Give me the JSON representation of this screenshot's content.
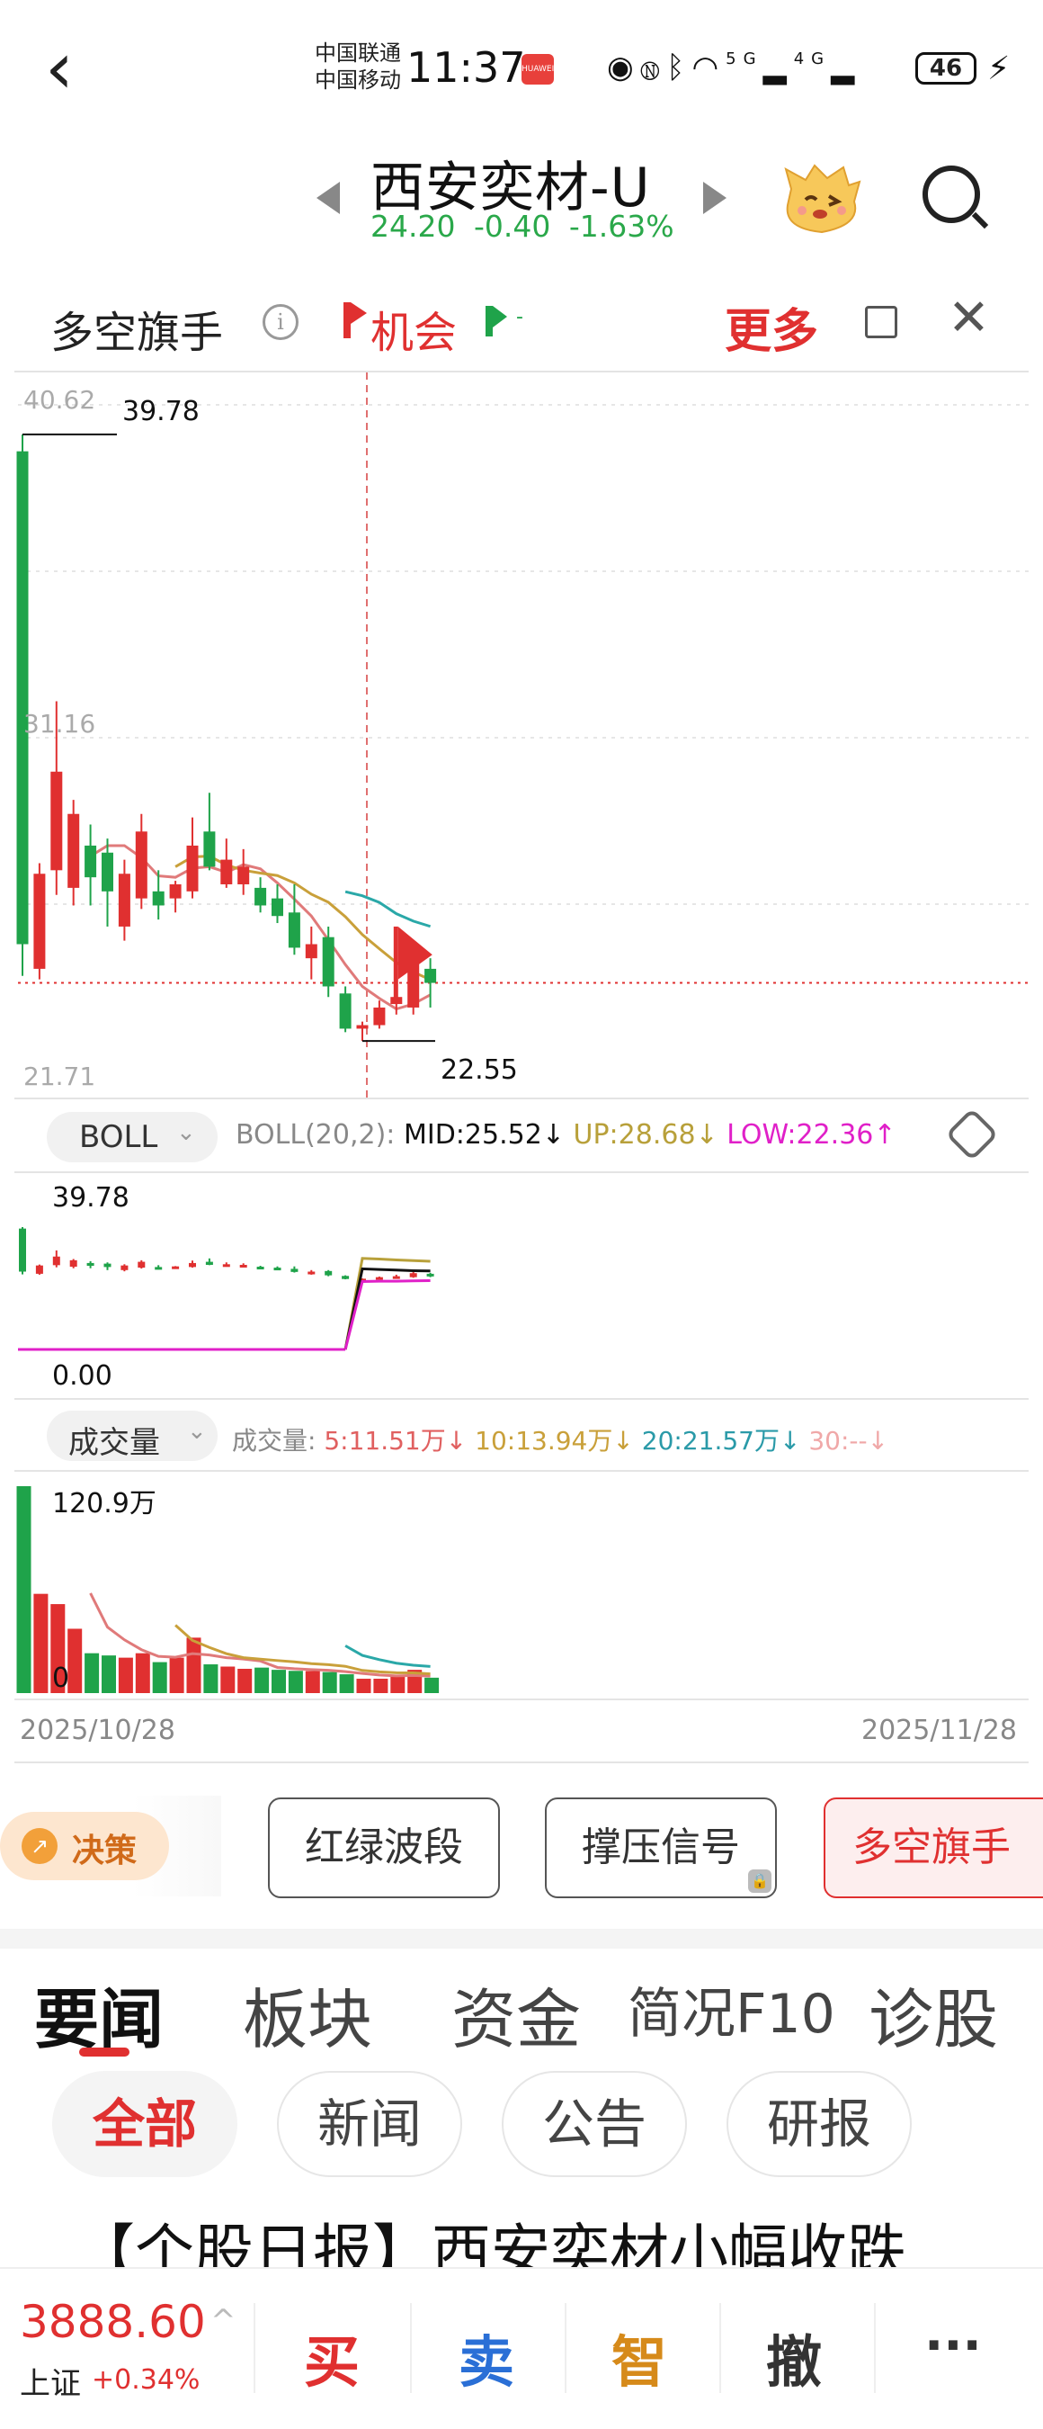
{
  "status_bar": {
    "carrier_1": "中国联通",
    "carrier_2": "中国移动",
    "time": "11:37",
    "net_1": "5G",
    "net_2": "4G",
    "battery": "46"
  },
  "header": {
    "stock_name": "西安奕材-U",
    "price": "24.20",
    "change": "-0.40",
    "change_pct": "-1.63%"
  },
  "tool": {
    "name": "多空旗手",
    "chance_label": "机会",
    "flag_label": "-",
    "more": "更多"
  },
  "main_chart": {
    "top_price": "40.62",
    "mid_price": "31.16",
    "bottom_price": "21.71",
    "high_marker": "39.78",
    "low_marker": "22.55"
  },
  "boll": {
    "selector": "BOLL",
    "params": "BOLL(20,2):",
    "mid": "MID:25.52",
    "up": "UP:28.68",
    "low": "LOW:22.36",
    "top_value": "39.78",
    "bottom_value": "0.00"
  },
  "volume": {
    "selector": "成交量",
    "label": "成交量:",
    "ma5": "5:11.51万",
    "ma10": "10:13.94万",
    "ma20": "20:21.57万",
    "ma30": "30:--",
    "top_value": "120.9万",
    "zero": "0",
    "date_start": "2025/10/28",
    "date_end": "2025/11/28"
  },
  "indicator_buttons": {
    "decision": "决策",
    "items": [
      "红绿波段",
      "撑压信号",
      "多空旗手"
    ]
  },
  "news_tabs": [
    "要闻",
    "板块",
    "资金",
    "简况F10",
    "诊股"
  ],
  "news_filters": [
    "全部",
    "新闻",
    "公告",
    "研报"
  ],
  "headline": "【个股日报】西安奕材小幅收跌",
  "bottom_bar": {
    "index_value": "3888.60",
    "index_name": "上证",
    "index_change": "+0.34%",
    "buy": "买",
    "sell": "卖",
    "smart": "智",
    "cancel": "撤",
    "more": "···"
  },
  "colors": {
    "up": "#e03030",
    "down": "#1fa34a",
    "boll_up": "#b8a03a",
    "boll_low": "#e020c8"
  },
  "chart_data": {
    "type": "candlestick",
    "x_range": [
      "2025/10/28",
      "2025/11/28"
    ],
    "ylim": [
      21.71,
      40.62
    ],
    "candles": [
      {
        "o": 39.3,
        "h": 39.78,
        "l": 24.4,
        "c": 25.3
      },
      {
        "o": 24.6,
        "h": 27.6,
        "l": 24.3,
        "c": 27.3
      },
      {
        "o": 27.4,
        "h": 32.2,
        "l": 26.7,
        "c": 30.2
      },
      {
        "o": 26.9,
        "h": 29.4,
        "l": 26.4,
        "c": 29.0
      },
      {
        "o": 28.1,
        "h": 28.7,
        "l": 26.4,
        "c": 27.2
      },
      {
        "o": 27.9,
        "h": 28.3,
        "l": 25.8,
        "c": 26.8
      },
      {
        "o": 25.8,
        "h": 27.7,
        "l": 25.4,
        "c": 27.3
      },
      {
        "o": 26.6,
        "h": 29.0,
        "l": 26.3,
        "c": 28.5
      },
      {
        "o": 26.8,
        "h": 27.4,
        "l": 26.0,
        "c": 26.4
      },
      {
        "o": 26.6,
        "h": 27.1,
        "l": 26.2,
        "c": 27.0
      },
      {
        "o": 26.8,
        "h": 28.9,
        "l": 26.6,
        "c": 28.1
      },
      {
        "o": 28.5,
        "h": 29.6,
        "l": 27.4,
        "c": 27.5
      },
      {
        "o": 27.0,
        "h": 28.3,
        "l": 26.9,
        "c": 27.7
      },
      {
        "o": 27.0,
        "h": 28.0,
        "l": 26.7,
        "c": 27.5
      },
      {
        "o": 26.9,
        "h": 27.2,
        "l": 26.2,
        "c": 26.4
      },
      {
        "o": 26.6,
        "h": 27.0,
        "l": 25.9,
        "c": 26.1
      },
      {
        "o": 26.2,
        "h": 27.0,
        "l": 25.0,
        "c": 25.2
      },
      {
        "o": 24.9,
        "h": 25.8,
        "l": 24.3,
        "c": 25.3
      },
      {
        "o": 25.5,
        "h": 25.8,
        "l": 23.8,
        "c": 24.1
      },
      {
        "o": 23.9,
        "h": 24.1,
        "l": 22.8,
        "c": 22.9
      },
      {
        "o": 22.9,
        "h": 23.1,
        "l": 22.55,
        "c": 23.0
      },
      {
        "o": 23.0,
        "h": 23.7,
        "l": 22.9,
        "c": 23.5
      },
      {
        "o": 23.6,
        "h": 24.3,
        "l": 23.3,
        "c": 23.8
      },
      {
        "o": 23.5,
        "h": 25.4,
        "l": 23.3,
        "c": 24.8
      },
      {
        "o": 24.6,
        "h": 24.9,
        "l": 23.5,
        "c": 24.2
      }
    ],
    "volume": [
      120.9,
      58.0,
      52.0,
      37.6,
      23.3,
      22.0,
      20.7,
      23.3,
      18.1,
      20.7,
      32.4,
      16.8,
      15.5,
      14.2,
      14.9,
      13.6,
      13.0,
      12.9,
      12.3,
      11.0,
      8.4,
      8.4,
      10.3,
      13.6,
      9.0
    ],
    "high_label": "39.78",
    "low_label": "22.55"
  }
}
